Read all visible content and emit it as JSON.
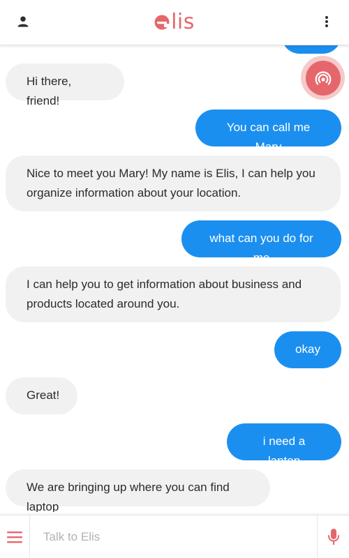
{
  "app": {
    "logo_text": "lis",
    "brand_color": "#e5676b",
    "user_bubble_color": "#1b8ff0",
    "bot_bubble_color": "#f1f1f1"
  },
  "header": {
    "user_icon": "person-icon",
    "menu_icon": "more-vertical-icon"
  },
  "fab": {
    "icon": "broadcast-icon"
  },
  "messages": [
    {
      "sender": "user",
      "text": ""
    },
    {
      "sender": "bot",
      "text": "Hi there, friend!"
    },
    {
      "sender": "user",
      "text": "You can call me Mary"
    },
    {
      "sender": "bot",
      "text": "Nice to meet you Mary! My name is Elis, I can help you organize information about your location."
    },
    {
      "sender": "user",
      "text": "what can you do for me"
    },
    {
      "sender": "bot",
      "text": "I can help you to get information about business and products located around you."
    },
    {
      "sender": "user",
      "text": "okay"
    },
    {
      "sender": "bot",
      "text": "Great!"
    },
    {
      "sender": "user",
      "text": "i need a laptop"
    },
    {
      "sender": "bot",
      "text": "We are bringing up where you can find laptop"
    }
  ],
  "composer": {
    "placeholder": "Talk to Elis",
    "value": "",
    "menu_icon": "hamburger-menu-icon",
    "mic_icon": "microphone-icon"
  }
}
